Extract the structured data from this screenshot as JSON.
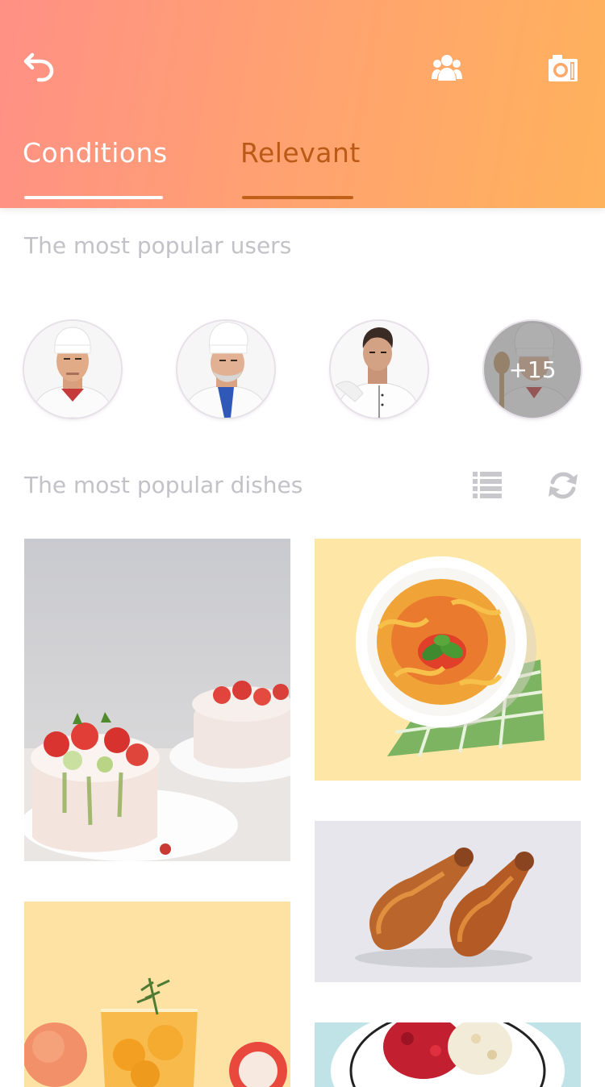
{
  "header": {
    "tabs": [
      {
        "label": "Conditions",
        "active": false
      },
      {
        "label": "Relevant",
        "active": true
      }
    ],
    "icons": [
      "undo-icon",
      "users-icon",
      "camera-icon"
    ]
  },
  "users_section": {
    "title": "The most popular users",
    "avatars": [
      {
        "name": "chef-avatar-1"
      },
      {
        "name": "chef-avatar-2"
      },
      {
        "name": "chef-avatar-3"
      },
      {
        "name": "chef-avatar-more",
        "overlay": "+15"
      }
    ]
  },
  "dishes_section": {
    "title": "The most popular dishes",
    "icons": [
      "list-icon",
      "refresh-icon"
    ],
    "cards": [
      "strawberry-cake",
      "pasta-plate",
      "chicken-wings",
      "orange-drink",
      "salad-bowl"
    ]
  },
  "colors": {
    "gradient_start": "#ff9085",
    "gradient_end": "#ffb25c",
    "active_tab": "#bb5a16",
    "section_title": "#c2c2c8"
  }
}
